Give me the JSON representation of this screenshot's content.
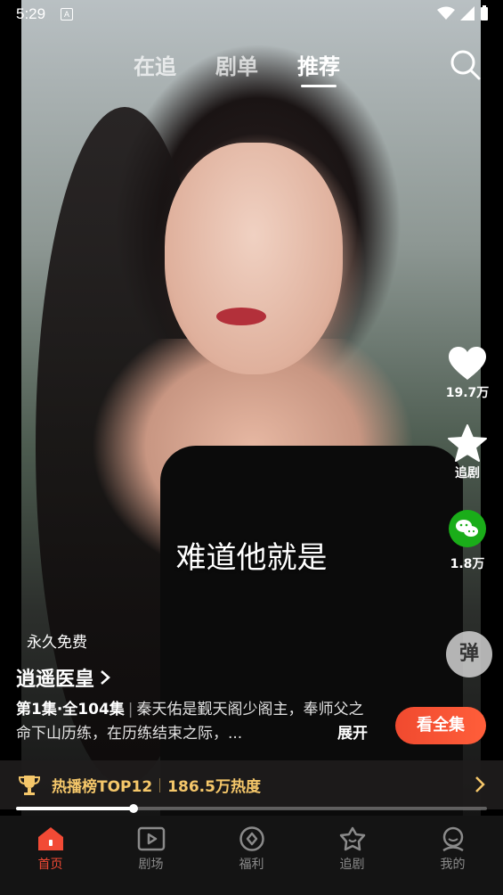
{
  "status_bar": {
    "time": "5:29",
    "notification_icon": "A"
  },
  "top_tabs": [
    {
      "label": "在追",
      "active": false
    },
    {
      "label": "剧单",
      "active": false
    },
    {
      "label": "推荐",
      "active": true
    }
  ],
  "video": {
    "subtitle": "难道他就是"
  },
  "side_actions": {
    "like_count": "19.7万",
    "follow_label": "追剧",
    "share_count": "1.8万",
    "danmu_label": "弹"
  },
  "drama": {
    "free_tag": "永久免费",
    "title": "逍遥医皇",
    "episode_info": "第1集·全104集",
    "description": "秦天佑是觐天阁少阁主，奉师父之命下山历练，在历练结束之际，...",
    "expand_label": "展开",
    "watch_all_label": "看全集"
  },
  "hot_rank": {
    "rank_label": "热播榜TOP12",
    "heat_label": "186.5万热度"
  },
  "progress": {
    "fraction": 0.25
  },
  "bottom_nav": [
    {
      "label": "首页",
      "icon": "home-icon",
      "active": true
    },
    {
      "label": "剧场",
      "icon": "theater-icon",
      "active": false
    },
    {
      "label": "福利",
      "icon": "welfare-icon",
      "active": false
    },
    {
      "label": "追剧",
      "icon": "follow-icon",
      "active": false
    },
    {
      "label": "我的",
      "icon": "profile-icon",
      "active": false
    }
  ],
  "colors": {
    "accent": "#f24a35",
    "hot_gold": "#f5c76a",
    "wechat_green": "#1aad19"
  }
}
